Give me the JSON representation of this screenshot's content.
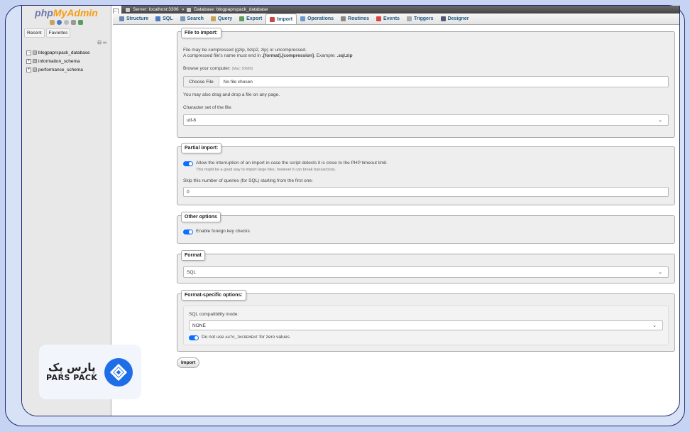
{
  "sidebar": {
    "logo_php": "php",
    "logo_myadmin": "MyAdmin",
    "tabs": [
      "Recent",
      "Favorites"
    ],
    "databases": [
      "blogpaprspack_database",
      "information_schema",
      "performance_schema"
    ]
  },
  "breadcrumb": {
    "server": "Server: localhost:3306",
    "separator": "»",
    "database": "Database: blogpaprspack_database"
  },
  "tabs": [
    {
      "label": "Structure",
      "icon": "structure-icon",
      "color": "#6a8ab3"
    },
    {
      "label": "SQL",
      "icon": "sql-icon",
      "color": "#4a7ac6"
    },
    {
      "label": "Search",
      "icon": "search-icon",
      "color": "#7a9ab8"
    },
    {
      "label": "Query",
      "icon": "query-icon",
      "color": "#c9a35c"
    },
    {
      "label": "Export",
      "icon": "export-icon",
      "color": "#5c9c5c"
    },
    {
      "label": "Import",
      "icon": "import-icon",
      "color": "#c44"
    },
    {
      "label": "Operations",
      "icon": "operations-icon",
      "color": "#6a9ad0"
    },
    {
      "label": "Routines",
      "icon": "routines-icon",
      "color": "#888"
    },
    {
      "label": "Events",
      "icon": "events-icon",
      "color": "#d44"
    },
    {
      "label": "Triggers",
      "icon": "triggers-icon",
      "color": "#aaa"
    },
    {
      "label": "Designer",
      "icon": "designer-icon",
      "color": "#557"
    }
  ],
  "file_import": {
    "legend": "File to import:",
    "line1": "File may be compressed (gzip, bzip2, zip) or uncompressed.",
    "line2_prefix": "A compressed file's name must end in ",
    "line2_bold": ".[format].[compression]",
    "line2_mid": ". Example: ",
    "line2_example": ".sql.zip",
    "browse_label": "Browse your computer:",
    "max": "(Max: 50MiB)",
    "choose_button": "Choose File",
    "no_file": "No file chosen",
    "drag_hint": "You may also drag and drop a file on any page.",
    "charset_label": "Character set of the file:",
    "charset_value": "utf-8"
  },
  "partial_import": {
    "legend": "Partial import:",
    "allow_interrupt": "Allow the interruption of an import in case the script detects it is close to the PHP timeout limit.",
    "allow_hint": "This might be a good way to import large files, however it can break transactions.",
    "skip_label": "Skip this number of queries (for SQL) starting from the first one:",
    "skip_value": "0"
  },
  "other_options": {
    "legend": "Other options",
    "fk_checks": "Enable foreign key checks"
  },
  "format": {
    "legend": "Format",
    "value": "SQL"
  },
  "format_specific": {
    "legend": "Format-specific options:",
    "compat_label": "SQL compatibility mode:",
    "compat_value": "NONE",
    "ai_prefix": "Do not use ",
    "ai_code": "AUTO_INCREMENT",
    "ai_suffix": " for zero values"
  },
  "import_button": "Import",
  "brand": {
    "fa": "پارس پک",
    "en": "PARS PACK",
    "color": "#1e6ee8"
  }
}
